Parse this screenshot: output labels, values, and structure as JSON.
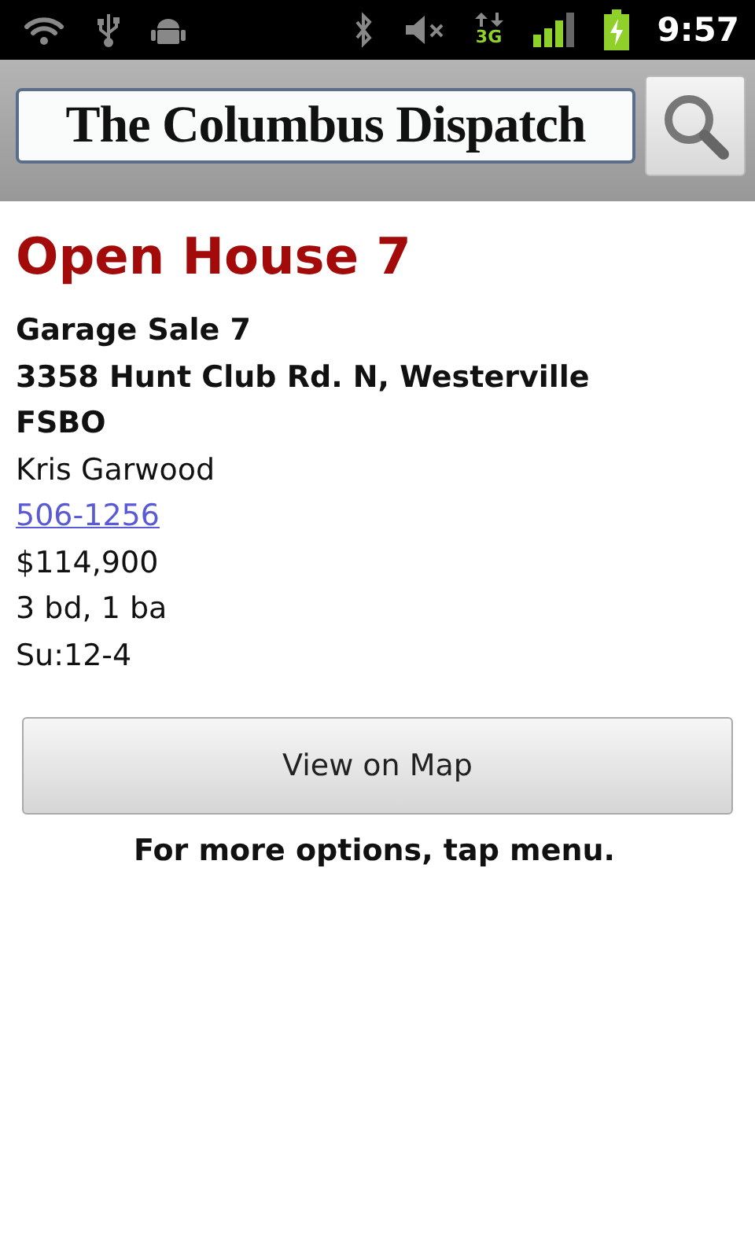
{
  "status_bar": {
    "network_label": "3G",
    "time": "9:57"
  },
  "header": {
    "logo": "The Columbus Dispatch"
  },
  "listing": {
    "title": "Open House 7",
    "lines": [
      {
        "kind": "bold",
        "text": "Garage Sale 7"
      },
      {
        "kind": "bold",
        "text": "3358 Hunt Club Rd. N, Westerville"
      },
      {
        "kind": "bold",
        "text": "FSBO"
      },
      {
        "kind": "plain",
        "text": "Kris Garwood"
      },
      {
        "kind": "link",
        "text": "506-1256"
      },
      {
        "kind": "plain",
        "text": "$114,900"
      },
      {
        "kind": "plain",
        "text": "3 bd, 1 ba"
      },
      {
        "kind": "plain",
        "text": "Su:12-4"
      }
    ],
    "button": "View on Map",
    "hint": "For more options, tap menu."
  }
}
